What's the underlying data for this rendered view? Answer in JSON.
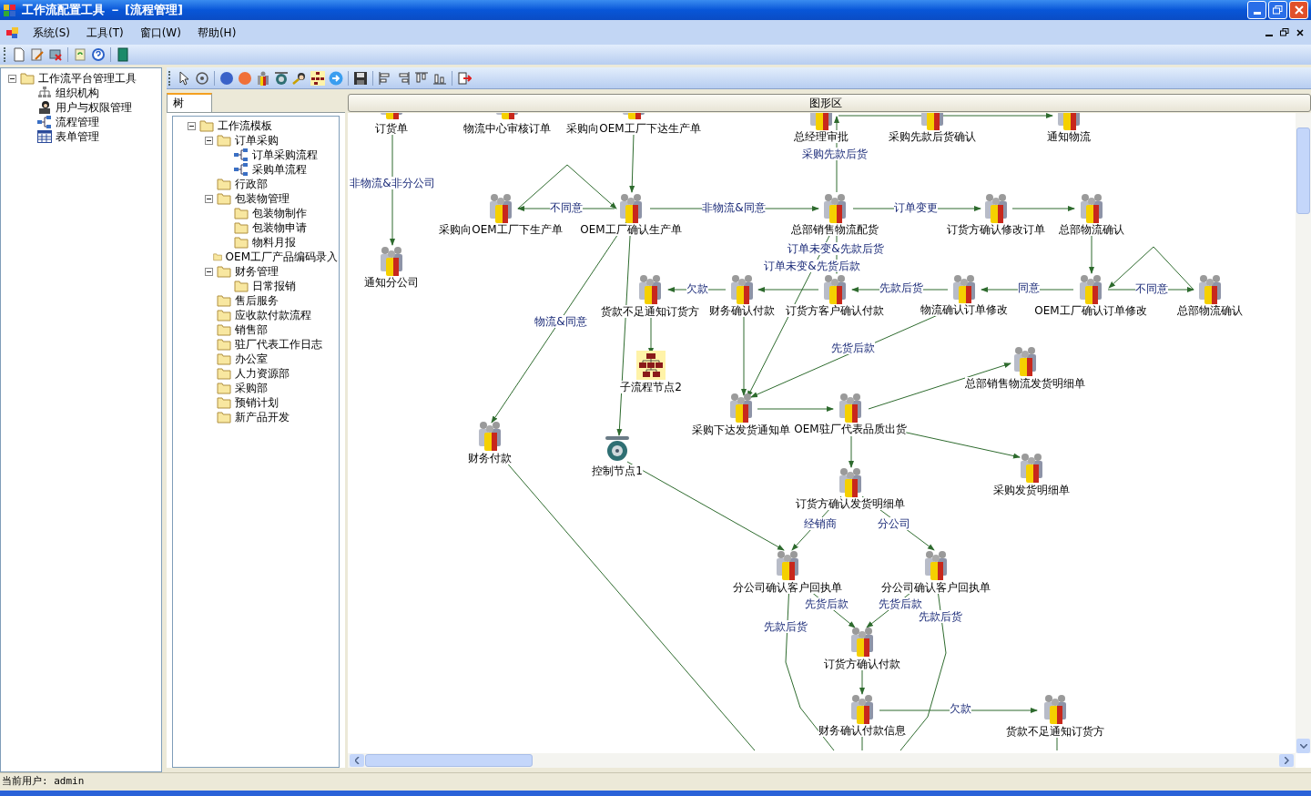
{
  "window": {
    "title": "工作流配置工具 － [流程管理]"
  },
  "menu": [
    "系统(S)",
    "工具(T)",
    "窗口(W)",
    "帮助(H)"
  ],
  "nav_tree": [
    {
      "label": "工作流平台管理工具",
      "kind": "folder",
      "expanded": true,
      "children": [
        {
          "label": "组织机构",
          "kind": "org"
        },
        {
          "label": "用户与权限管理",
          "kind": "user"
        },
        {
          "label": "流程管理",
          "kind": "flow"
        },
        {
          "label": "表单管理",
          "kind": "form"
        }
      ]
    }
  ],
  "tabs": [
    {
      "label": "树",
      "selected": true
    }
  ],
  "template_tree": [
    {
      "label": "工作流模板",
      "kind": "folder",
      "expanded": true,
      "children": [
        {
          "label": "订单采购",
          "kind": "folder",
          "expanded": true,
          "children": [
            {
              "label": "订单采购流程",
              "kind": "flow"
            },
            {
              "label": "采购单流程",
              "kind": "flow"
            }
          ]
        },
        {
          "label": "行政部",
          "kind": "folder"
        },
        {
          "label": "包装物管理",
          "kind": "folder",
          "expanded": true,
          "children": [
            {
              "label": "包装物制作",
              "kind": "folder"
            },
            {
              "label": "包装物申请",
              "kind": "folder"
            },
            {
              "label": "物料月报",
              "kind": "folder"
            }
          ]
        },
        {
          "label": "OEM工厂产品编码录入",
          "kind": "folder"
        },
        {
          "label": "财务管理",
          "kind": "folder",
          "expanded": true,
          "children": [
            {
              "label": "日常报销",
              "kind": "folder"
            }
          ]
        },
        {
          "label": "售后服务",
          "kind": "folder"
        },
        {
          "label": "应收款付款流程",
          "kind": "folder"
        },
        {
          "label": "销售部",
          "kind": "folder"
        },
        {
          "label": "驻厂代表工作日志",
          "kind": "folder"
        },
        {
          "label": "办公室",
          "kind": "folder"
        },
        {
          "label": "人力资源部",
          "kind": "folder"
        },
        {
          "label": "采购部",
          "kind": "folder"
        },
        {
          "label": "预销计划",
          "kind": "folder"
        },
        {
          "label": "新产品开发",
          "kind": "folder"
        }
      ]
    }
  ],
  "diagram": {
    "title": "图形区",
    "nodes": [
      {
        "label": "订货单",
        "kind": "role"
      },
      {
        "label": "物流中心审核订单",
        "kind": "role"
      },
      {
        "label": "采购向OEM工厂下达生产单",
        "kind": "role"
      },
      {
        "label": "总经理审批",
        "kind": "role"
      },
      {
        "label": "采购先款后货确认",
        "kind": "role"
      },
      {
        "label": "通知物流",
        "kind": "role"
      },
      {
        "label": "采购向OEM工厂下生产单",
        "kind": "role"
      },
      {
        "label": "OEM工厂确认生产单",
        "kind": "role"
      },
      {
        "label": "总部销售物流配货",
        "kind": "role"
      },
      {
        "label": "订货方确认修改订单",
        "kind": "role"
      },
      {
        "label": "总部物流确认",
        "kind": "role"
      },
      {
        "label": "通知分公司",
        "kind": "role"
      },
      {
        "label": "货款不足通知订货方",
        "kind": "role"
      },
      {
        "label": "财务确认付款",
        "kind": "role"
      },
      {
        "label": "订货方客户确认付款",
        "kind": "role"
      },
      {
        "label": "物流确认订单修改",
        "kind": "role"
      },
      {
        "label": "OEM工厂确认订单修改",
        "kind": "role"
      },
      {
        "label": "总部物流确认",
        "kind": "role"
      },
      {
        "label": "子流程节点2",
        "kind": "subflow"
      },
      {
        "label": "总部销售物流发货明细单",
        "kind": "role"
      },
      {
        "label": "采购下达发货通知单",
        "kind": "role"
      },
      {
        "label": "OEM驻厂代表品质出货",
        "kind": "role"
      },
      {
        "label": "财务付款",
        "kind": "role"
      },
      {
        "label": "控制节点1",
        "kind": "control"
      },
      {
        "label": "采购发货明细单",
        "kind": "role"
      },
      {
        "label": "订货方确认发货明细单",
        "kind": "role"
      },
      {
        "label": "分公司确认客户回执单",
        "kind": "role"
      },
      {
        "label": "分公司确认客户回执单",
        "kind": "role"
      },
      {
        "label": "订货方确认付款",
        "kind": "role"
      },
      {
        "label": "财务确认付款信息",
        "kind": "role"
      },
      {
        "label": "货款不足通知订货方",
        "kind": "role"
      }
    ],
    "edge_labels": [
      "非物流&非分公司",
      "不同意",
      "非物流&同意",
      "采购先款后货",
      "订单变更",
      "订单未变&先款后货",
      "订单未变&先货后款",
      "欠款",
      "先款后货",
      "同意",
      "不同意",
      "物流&同意",
      "先货后款",
      "经销商",
      "分公司",
      "先货后款",
      "先货后款",
      "先款后货",
      "先款后货",
      "欠款"
    ]
  },
  "status_bar": "当前用户: admin"
}
